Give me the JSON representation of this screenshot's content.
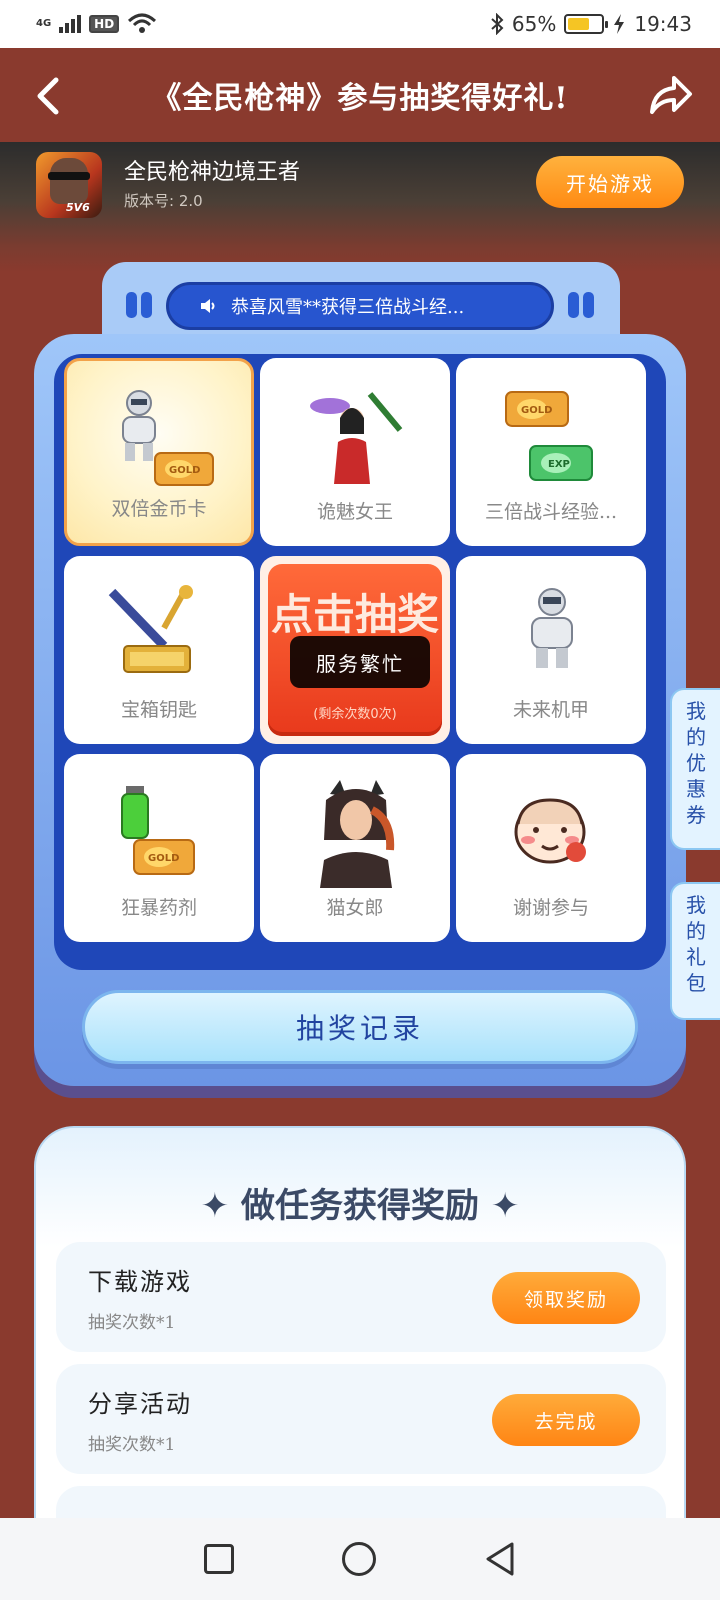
{
  "status_bar": {
    "network": "4G",
    "battery_percent": "65%",
    "battery_level": 0.65,
    "time": "19:43",
    "hd_label": "HD"
  },
  "header": {
    "title": "《全民枪神》参与抽奖得好礼!"
  },
  "game": {
    "name": "全民枪神边境王者",
    "version": "版本号: 2.0",
    "play_label": "开始游戏",
    "icon_tag": "5V6"
  },
  "notice": {
    "text": "恭喜风雪**获得三倍战斗经..."
  },
  "lottery": {
    "prizes": [
      {
        "label": "双倍金币卡"
      },
      {
        "label": "诡魅女王"
      },
      {
        "label": "三倍战斗经验..."
      },
      {
        "label": "宝箱钥匙"
      },
      {
        "label": "未来机甲"
      },
      {
        "label": "狂暴药剂"
      },
      {
        "label": "猫女郎"
      },
      {
        "label": "谢谢参与"
      }
    ],
    "draw_button_big": "点击抽奖",
    "draw_remaining": "(剩余次数0次)",
    "toast": "服务繁忙",
    "record_label": "抽奖记录"
  },
  "side_tabs": {
    "coupons": "我的优惠券",
    "gifts": "我的礼包"
  },
  "tasks": {
    "title": "✦ 做任务获得奖励 ✦",
    "items": [
      {
        "name": "下载游戏",
        "count": "抽奖次数*1",
        "button": "领取奖励"
      },
      {
        "name": "分享活动",
        "count": "抽奖次数*1",
        "button": "去完成"
      }
    ]
  },
  "colors": {
    "header_bg": "#8a3a2e",
    "accent_orange": "#ff8a12",
    "panel_blue": "#1f47b8"
  }
}
